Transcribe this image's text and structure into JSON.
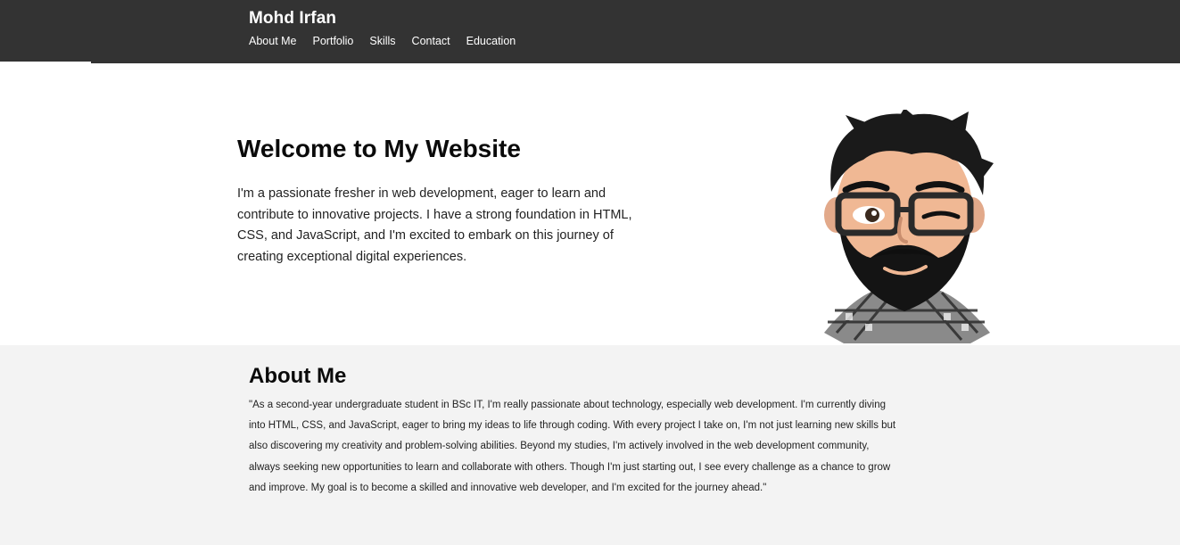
{
  "header": {
    "brand": "Mohd Irfan",
    "nav": [
      "About Me",
      "Portfolio",
      "Skills",
      "Contact",
      "Education"
    ],
    "background": "#333333"
  },
  "hero": {
    "title": "Welcome to My Website",
    "text": "I'm a passionate fresher in web development, eager to learn and contribute to innovative projects. I have a strong foundation in HTML, CSS, and JavaScript, and I'm excited to embark on this journey of creating exceptional digital experiences.",
    "avatar_icon": "bearded-man-avatar-icon"
  },
  "about": {
    "title": "About Me",
    "text": "\"As a second-year undergraduate student in BSc IT, I'm really passionate about technology, especially web development. I'm currently diving into HTML, CSS, and JavaScript, eager to bring my ideas to life through coding. With every project I take on, I'm not just learning new skills but also discovering my creativity and problem-solving abilities. Beyond my studies, I'm actively involved in the web development community, always seeking new opportunities to learn and collaborate with others. Though I'm just starting out, I see every challenge as a chance to grow and improve. My goal is to become a skilled and innovative web developer, and I'm excited for the journey ahead.\"",
    "background": "#f3f3f3"
  }
}
